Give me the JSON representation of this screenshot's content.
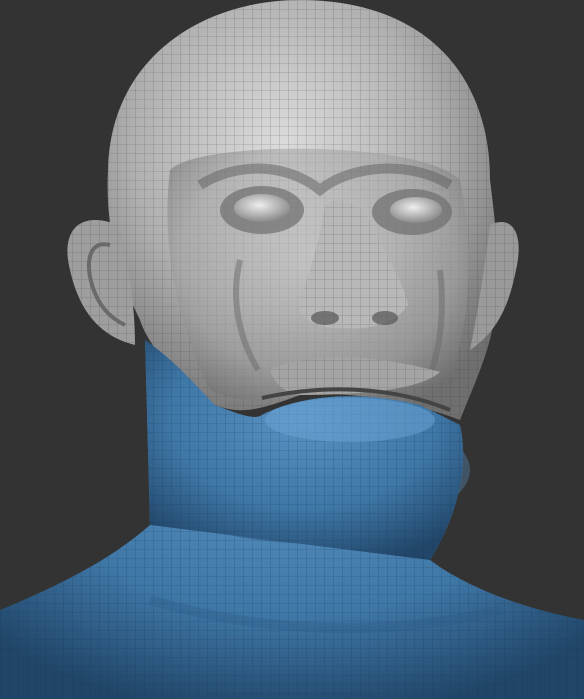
{
  "scene": {
    "subject": "sculpt-head-mesh",
    "background_color": "#333333",
    "clay_color": "#b4b4b4",
    "mask_color": "#3f77a6",
    "wire_color": "#3a3a3a"
  }
}
